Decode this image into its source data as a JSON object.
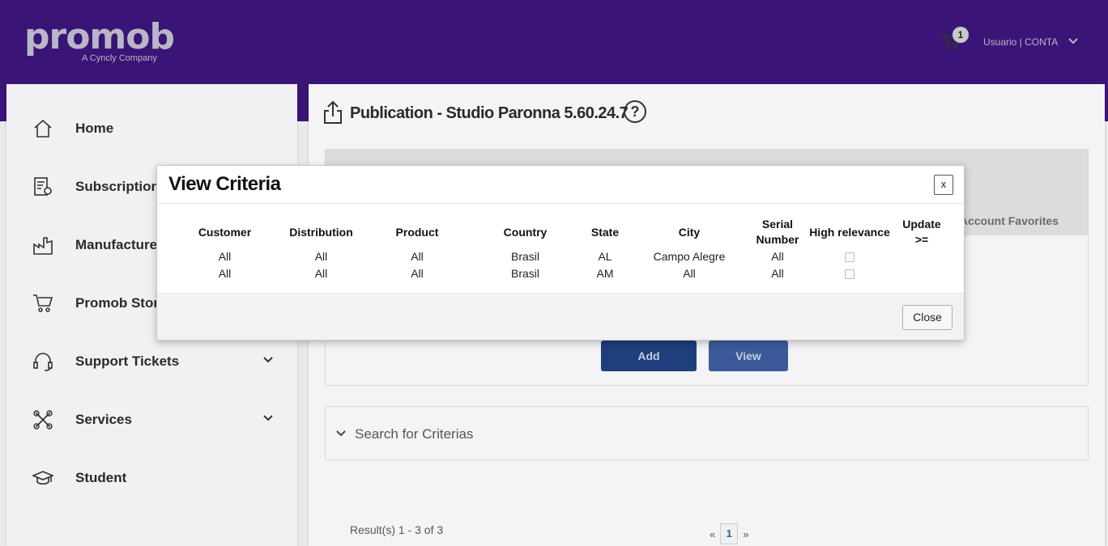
{
  "header": {
    "logo": "promob",
    "logo_sub": "A Cyncly Company",
    "cart_count": "1",
    "user_label": "Usuario | CONTA"
  },
  "sidebar": {
    "items": [
      {
        "label": "Home",
        "icon": "home-icon"
      },
      {
        "label": "Subscriptions",
        "icon": "subscriptions-icon"
      },
      {
        "label": "Manufacturers",
        "icon": "factory-icon"
      },
      {
        "label": "Promob Store",
        "icon": "cart-icon"
      },
      {
        "label": "Support Tickets",
        "icon": "headset-icon"
      },
      {
        "label": "Services",
        "icon": "tools-icon"
      },
      {
        "label": "Student",
        "icon": "graduation-cap-icon"
      }
    ]
  },
  "main": {
    "title": "Publication - Studio Paronna 5.60.24.7",
    "help": "?",
    "tab_favorites": "Account Favorites",
    "add_label": "Add",
    "view_label": "View",
    "search_label": "Search for Criterias",
    "results": "Result(s) 1 - 3 of 3",
    "pager": {
      "prev": "«",
      "page": "1",
      "next": "»"
    }
  },
  "modal": {
    "title": "View Criteria",
    "close_x": "x",
    "close_label": "Close",
    "columns": [
      "Customer",
      "Distribution",
      "Product",
      "Country",
      "State",
      "City",
      "Serial Number",
      "High relevance",
      "Update >="
    ],
    "rows": [
      {
        "customer": "All",
        "distribution": "All",
        "product": "All",
        "country": "Brasil",
        "state": "AL",
        "city": "Campo Alegre",
        "serial": "All",
        "high_relevance": false,
        "update": ""
      },
      {
        "customer": "All",
        "distribution": "All",
        "product": "All",
        "country": "Brasil",
        "state": "AM",
        "city": "All",
        "serial": "All",
        "high_relevance": false,
        "update": ""
      }
    ]
  }
}
